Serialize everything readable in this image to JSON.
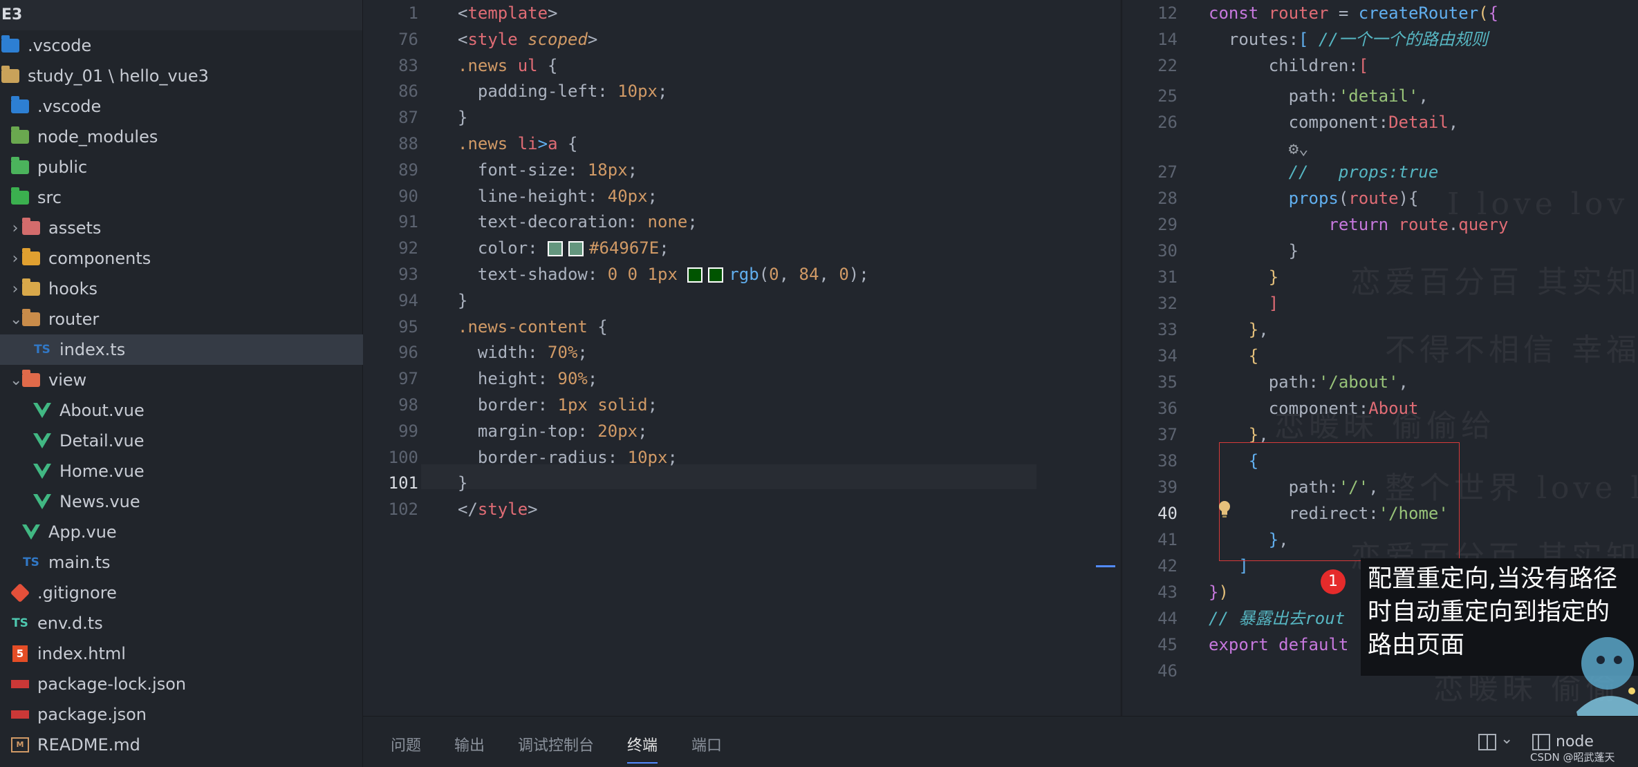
{
  "explorer": {
    "title": "E3",
    "items": [
      {
        "label": ".vscode",
        "icon": "vscode-folder-icon",
        "depth": 0,
        "chevron": ""
      },
      {
        "label": "study_01 \\ hello_vue3",
        "icon": "folder-icon",
        "depth": 0,
        "chevron": ""
      },
      {
        "label": ".vscode",
        "icon": "vscode-folder-icon",
        "depth": 1,
        "chevron": ""
      },
      {
        "label": "node_modules",
        "icon": "node-folder-icon",
        "depth": 1,
        "chevron": ""
      },
      {
        "label": "public",
        "icon": "public-folder-icon",
        "depth": 1,
        "chevron": ""
      },
      {
        "label": "src",
        "icon": "src-folder-icon",
        "depth": 1,
        "chevron": ""
      },
      {
        "label": "assets",
        "icon": "assets-folder-icon",
        "depth": 2,
        "chevron": "›"
      },
      {
        "label": "components",
        "icon": "components-folder-icon",
        "depth": 2,
        "chevron": "›"
      },
      {
        "label": "hooks",
        "icon": "hooks-folder-icon",
        "depth": 2,
        "chevron": "›"
      },
      {
        "label": "router",
        "icon": "router-folder-icon",
        "depth": 2,
        "chevron": "⌄"
      },
      {
        "label": "index.ts",
        "icon": "ts-file-icon",
        "depth": 3,
        "chevron": ""
      },
      {
        "label": "view",
        "icon": "view-folder-icon",
        "depth": 2,
        "chevron": "⌄"
      },
      {
        "label": "About.vue",
        "icon": "vue-file-icon",
        "depth": 3,
        "chevron": ""
      },
      {
        "label": "Detail.vue",
        "icon": "vue-file-icon",
        "depth": 3,
        "chevron": ""
      },
      {
        "label": "Home.vue",
        "icon": "vue-file-icon",
        "depth": 3,
        "chevron": ""
      },
      {
        "label": "News.vue",
        "icon": "vue-file-icon",
        "depth": 3,
        "chevron": ""
      },
      {
        "label": "App.vue",
        "icon": "vue-file-icon",
        "depth": 2,
        "chevron": ""
      },
      {
        "label": "main.ts",
        "icon": "ts-file-icon",
        "depth": 2,
        "chevron": ""
      },
      {
        "label": ".gitignore",
        "icon": "git-file-icon",
        "depth": 1,
        "chevron": ""
      },
      {
        "label": "env.d.ts",
        "icon": "ts-def-file-icon",
        "depth": 1,
        "chevron": ""
      },
      {
        "label": "index.html",
        "icon": "html-file-icon",
        "depth": 1,
        "chevron": ""
      },
      {
        "label": "package-lock.json",
        "icon": "npm-file-icon",
        "depth": 1,
        "chevron": ""
      },
      {
        "label": "package.json",
        "icon": "npm-file-icon",
        "depth": 1,
        "chevron": ""
      },
      {
        "label": "README.md",
        "icon": "markdown-file-icon",
        "depth": 1,
        "chevron": ""
      }
    ],
    "selected_label": "index.ts"
  },
  "left_editor": {
    "current_line": "101",
    "lines": [
      {
        "n": "1",
        "tokens": [
          [
            "punct",
            "<"
          ],
          [
            "tag",
            "template"
          ],
          [
            "punct",
            ">"
          ]
        ]
      },
      {
        "n": "76",
        "tokens": [
          [
            "punct",
            "<"
          ],
          [
            "tag",
            "style"
          ],
          [
            "punct",
            " "
          ],
          [
            "selitalic",
            "scoped"
          ],
          [
            "punct",
            ">"
          ]
        ]
      },
      {
        "n": "83",
        "tokens": [
          [
            "sel",
            ".news "
          ],
          [
            "tag",
            "ul"
          ],
          [
            "punct",
            " {"
          ]
        ]
      },
      {
        "n": "86",
        "tokens": [
          [
            "prop",
            "  padding-left: "
          ],
          [
            "num",
            "10px"
          ],
          [
            "punct",
            ";"
          ]
        ]
      },
      {
        "n": "87",
        "tokens": [
          [
            "punct",
            "}"
          ]
        ]
      },
      {
        "n": "88",
        "tokens": [
          [
            "sel",
            ".news "
          ],
          [
            "tag",
            "li"
          ],
          [
            "fn",
            ">"
          ],
          [
            "tag",
            "a"
          ],
          [
            "punct",
            " {"
          ]
        ]
      },
      {
        "n": "89",
        "tokens": [
          [
            "prop",
            "  font-size: "
          ],
          [
            "num",
            "18px"
          ],
          [
            "punct",
            ";"
          ]
        ]
      },
      {
        "n": "90",
        "tokens": [
          [
            "prop",
            "  line-height: "
          ],
          [
            "num",
            "40px"
          ],
          [
            "punct",
            ";"
          ]
        ]
      },
      {
        "n": "91",
        "tokens": [
          [
            "prop",
            "  text-decoration: "
          ],
          [
            "val",
            "none"
          ],
          [
            "punct",
            ";"
          ]
        ]
      },
      {
        "n": "92",
        "tokens": [
          [
            "prop",
            "  color: "
          ],
          [
            "swatch",
            "#64967E"
          ],
          [
            "swatch",
            "#64967E"
          ],
          [
            "num",
            "#64967E"
          ],
          [
            "punct",
            ";"
          ]
        ]
      },
      {
        "n": "93",
        "tokens": [
          [
            "prop",
            "  text-shadow: "
          ],
          [
            "num",
            "0 0 1px "
          ],
          [
            "swatch",
            "#005400"
          ],
          [
            "swatch",
            "#005400"
          ],
          [
            "fn",
            "rgb"
          ],
          [
            "punct",
            "("
          ],
          [
            "num",
            "0"
          ],
          [
            "punct",
            ", "
          ],
          [
            "num",
            "84"
          ],
          [
            "punct",
            ", "
          ],
          [
            "num",
            "0"
          ],
          [
            "punct",
            ");"
          ]
        ]
      },
      {
        "n": "94",
        "tokens": [
          [
            "punct",
            "}"
          ]
        ]
      },
      {
        "n": "95",
        "tokens": [
          [
            "sel",
            ".news-content"
          ],
          [
            "punct",
            " {"
          ]
        ]
      },
      {
        "n": "96",
        "tokens": [
          [
            "prop",
            "  width: "
          ],
          [
            "num",
            "70%"
          ],
          [
            "punct",
            ";"
          ]
        ]
      },
      {
        "n": "97",
        "tokens": [
          [
            "prop",
            "  height: "
          ],
          [
            "num",
            "90%"
          ],
          [
            "punct",
            ";"
          ]
        ]
      },
      {
        "n": "98",
        "tokens": [
          [
            "prop",
            "  border: "
          ],
          [
            "num",
            "1px"
          ],
          [
            "val",
            " solid"
          ],
          [
            "punct",
            ";"
          ]
        ]
      },
      {
        "n": "99",
        "tokens": [
          [
            "prop",
            "  margin-top: "
          ],
          [
            "num",
            "20px"
          ],
          [
            "punct",
            ";"
          ]
        ]
      },
      {
        "n": "100",
        "tokens": [
          [
            "prop",
            "  border-radius: "
          ],
          [
            "num",
            "10px"
          ],
          [
            "punct",
            ";"
          ]
        ]
      },
      {
        "n": "101",
        "tokens": [
          [
            "punct",
            "}"
          ]
        ]
      },
      {
        "n": "102",
        "tokens": [
          [
            "punct",
            "</"
          ],
          [
            "tag",
            "style"
          ],
          [
            "punct",
            ">"
          ]
        ]
      }
    ]
  },
  "right_editor": {
    "current_line": "40",
    "lines": [
      {
        "n": "12",
        "tokens": [
          [
            "kw",
            "const "
          ],
          [
            "var",
            "router"
          ],
          [
            "punct",
            " = "
          ],
          [
            "fn",
            "createRouter"
          ],
          [
            "brk4",
            "("
          ],
          [
            "brk2",
            "{"
          ]
        ]
      },
      {
        "n": "14",
        "tokens": [
          [
            "prop",
            "  routes:"
          ],
          [
            "brk3",
            "[ "
          ],
          [
            "cmtblue",
            "//一个一个的路由规则"
          ]
        ]
      },
      {
        "n": "22",
        "tokens": [
          [
            "prop",
            "      children:"
          ],
          [
            "var",
            "["
          ]
        ]
      },
      {
        "n": "25",
        "tokens": [
          [
            "prop",
            "        path:"
          ],
          [
            "str",
            "'detail'"
          ],
          [
            "punct",
            ","
          ]
        ]
      },
      {
        "n": "26",
        "tokens": [
          [
            "prop",
            "        component:"
          ],
          [
            "var",
            "Detail"
          ],
          [
            "punct",
            ","
          ]
        ]
      },
      {
        "n": "",
        "tokens": [
          [
            "ai",
            "        ⚙⌄"
          ]
        ]
      },
      {
        "n": "27",
        "tokens": [
          [
            "cmtblue",
            "        //   props:true"
          ]
        ]
      },
      {
        "n": "28",
        "tokens": [
          [
            "fn",
            "        props"
          ],
          [
            "punct",
            "("
          ],
          [
            "var",
            "route"
          ],
          [
            "punct",
            "){"
          ]
        ]
      },
      {
        "n": "29",
        "tokens": [
          [
            "kw",
            "            return "
          ],
          [
            "var",
            "route"
          ],
          [
            "punct",
            "."
          ],
          [
            "var",
            "query"
          ]
        ]
      },
      {
        "n": "30",
        "tokens": [
          [
            "punct",
            "        }"
          ]
        ]
      },
      {
        "n": "31",
        "tokens": [
          [
            "brk4",
            "      }"
          ]
        ]
      },
      {
        "n": "32",
        "tokens": [
          [
            "var",
            "      ]"
          ]
        ]
      },
      {
        "n": "33",
        "tokens": [
          [
            "brk4",
            "    }"
          ],
          [
            "punct",
            ","
          ]
        ]
      },
      {
        "n": "34",
        "tokens": [
          [
            "brk4",
            "    {"
          ]
        ]
      },
      {
        "n": "35",
        "tokens": [
          [
            "prop",
            "      path:"
          ],
          [
            "str",
            "'/about'"
          ],
          [
            "punct",
            ","
          ]
        ]
      },
      {
        "n": "36",
        "tokens": [
          [
            "prop",
            "      component:"
          ],
          [
            "var",
            "About"
          ]
        ]
      },
      {
        "n": "37",
        "tokens": [
          [
            "brk4",
            "    }"
          ],
          [
            "punct",
            ","
          ]
        ]
      },
      {
        "n": "38",
        "tokens": [
          [
            "brk3box",
            "    {"
          ]
        ]
      },
      {
        "n": "39",
        "tokens": [
          [
            "prop",
            "        path:"
          ],
          [
            "str",
            "'/'"
          ],
          [
            "punct",
            ","
          ]
        ]
      },
      {
        "n": "40",
        "tokens": [
          [
            "prop",
            "        redirect:"
          ],
          [
            "str",
            "'/home'"
          ]
        ]
      },
      {
        "n": "41",
        "tokens": [
          [
            "brk3box",
            "      }"
          ],
          [
            "punct",
            ","
          ]
        ]
      },
      {
        "n": "42",
        "tokens": [
          [
            "brk3",
            "   ]"
          ]
        ]
      },
      {
        "n": "43",
        "tokens": [
          [
            "brk2",
            "}"
          ],
          [
            "brk4",
            ")"
          ]
        ]
      },
      {
        "n": "44",
        "tokens": [
          [
            "cmtblue",
            "// 暴露出去rout"
          ]
        ]
      },
      {
        "n": "45",
        "tokens": [
          [
            "kw",
            "export default"
          ]
        ]
      },
      {
        "n": "46",
        "tokens": []
      }
    ]
  },
  "watermark_lines": [
    "I love lov",
    "恋爱百分百 其实知",
    "不得不相信 幸福总",
    "恋暖昧 偷偷给",
    "整个世界 love lo",
    "恋爱百分百 其实知",
    "恋暖昧 偷偷"
  ],
  "callout": {
    "badge": "1",
    "text": "配置重定向,当没有路径时自动重定向到指定的路由页面"
  },
  "panel": {
    "tabs": [
      "问题",
      "输出",
      "调试控制台",
      "终端",
      "端口"
    ],
    "active_tab": "终端",
    "right_label": "node",
    "credit": "CSDN @昭武蓬天"
  },
  "colors": {
    "bg": "#22262d",
    "sidebar": "#21252b",
    "selected": "#353b45",
    "accent": "#528bff",
    "highlight_box": "#d83a3a",
    "badge": "#e52b2b"
  }
}
